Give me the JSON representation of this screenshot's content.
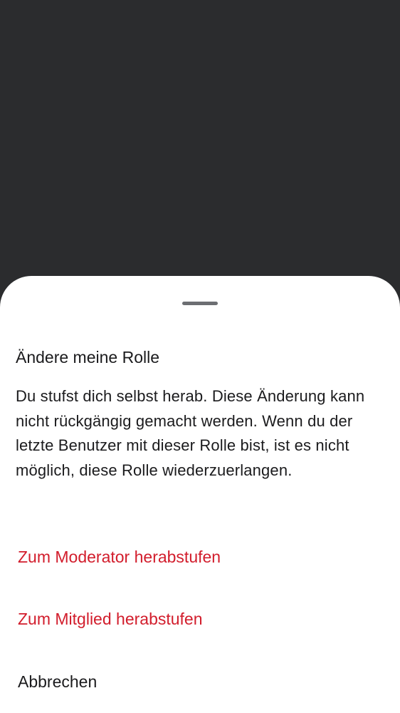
{
  "sheet": {
    "title": "Ändere meine Rolle",
    "body": "Du stufst dich selbst herab. Diese Änderung kann nicht rückgängig gemacht werden. Wenn du der letzte Benutzer mit dieser Rolle bist, ist es nicht möglich, diese Rolle wiederzuerlangen.",
    "actions": [
      {
        "label": "Zum Moderator herabstufen",
        "style": "destructive"
      },
      {
        "label": "Zum Mitglied herabstufen",
        "style": "destructive"
      },
      {
        "label": "Abbrechen",
        "style": "neutral"
      }
    ]
  },
  "colors": {
    "scrim": "#2b2c2e",
    "sheet_background": "#ffffff",
    "destructive_text": "#d21d2c",
    "primary_text": "#1b1b1d",
    "handle": "#6c6e72"
  }
}
